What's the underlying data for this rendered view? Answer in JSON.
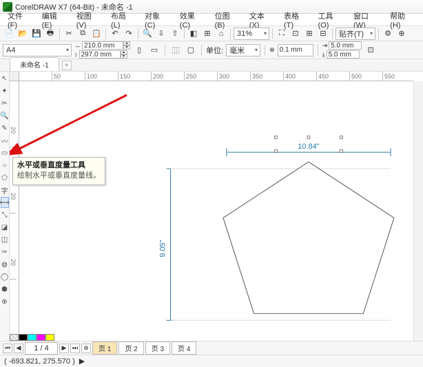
{
  "title": "CorelDRAW X7 (64-Bit) - 未命名 -1",
  "menu": [
    "文件(F)",
    "编辑(E)",
    "视图(V)",
    "布局(L)",
    "对象(C)",
    "效果(C)",
    "位图(B)",
    "文本(X)",
    "表格(T)",
    "工具(O)",
    "窗口(W)",
    "帮助(H)"
  ],
  "zoom": "31%",
  "paste_label": "贴齐(T)",
  "paper": "A4",
  "page_w": "210.0 mm",
  "page_h": "297.0 mm",
  "units_label": "单位:",
  "units_value": "毫米",
  "nudge": "0.1 mm",
  "dup_x": "5.0 mm",
  "dup_y": "5.0 mm",
  "doc_tab": "未命名 -1",
  "ruler_h": [
    "",
    "50",
    "100",
    "150",
    "200",
    "250",
    "300",
    "350",
    "400",
    "450",
    "500",
    "550"
  ],
  "ruler_v": [
    "",
    "20",
    "",
    "20",
    "",
    "20",
    "",
    "20"
  ],
  "dim_horizontal": "10.84\"",
  "dim_vertical": "9.05\"",
  "tooltip_title": "水平或垂直度量工具",
  "tooltip_desc": "绘制水平或垂直度量线。",
  "page_counter": "1 / 4",
  "page_tabs": [
    "页 1",
    "页 2",
    "页 3",
    "页 4"
  ],
  "status_coords": "( -693.821, 275.570 )",
  "arrow_sym": "▶"
}
